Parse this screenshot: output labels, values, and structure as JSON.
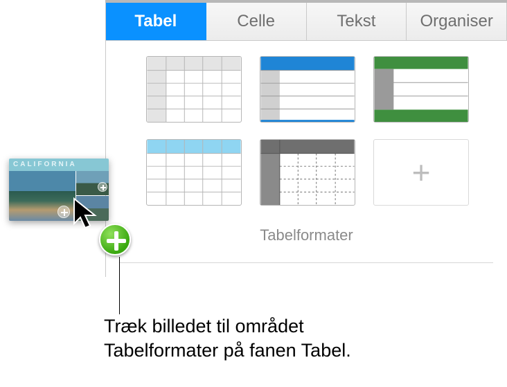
{
  "tabs": {
    "tabel": "Tabel",
    "celle": "Celle",
    "tekst": "Tekst",
    "organiser": "Organiser"
  },
  "section_label": "Tabelformater",
  "drag_label": "CALIFORNIA",
  "caption_line1": "Træk billedet til området",
  "caption_line2": "Tabelformater på fanen Tabel.",
  "colors": {
    "accent": "#0a91ff",
    "green_header": "#3f8f3f",
    "blue_header": "#4aa8e0"
  }
}
